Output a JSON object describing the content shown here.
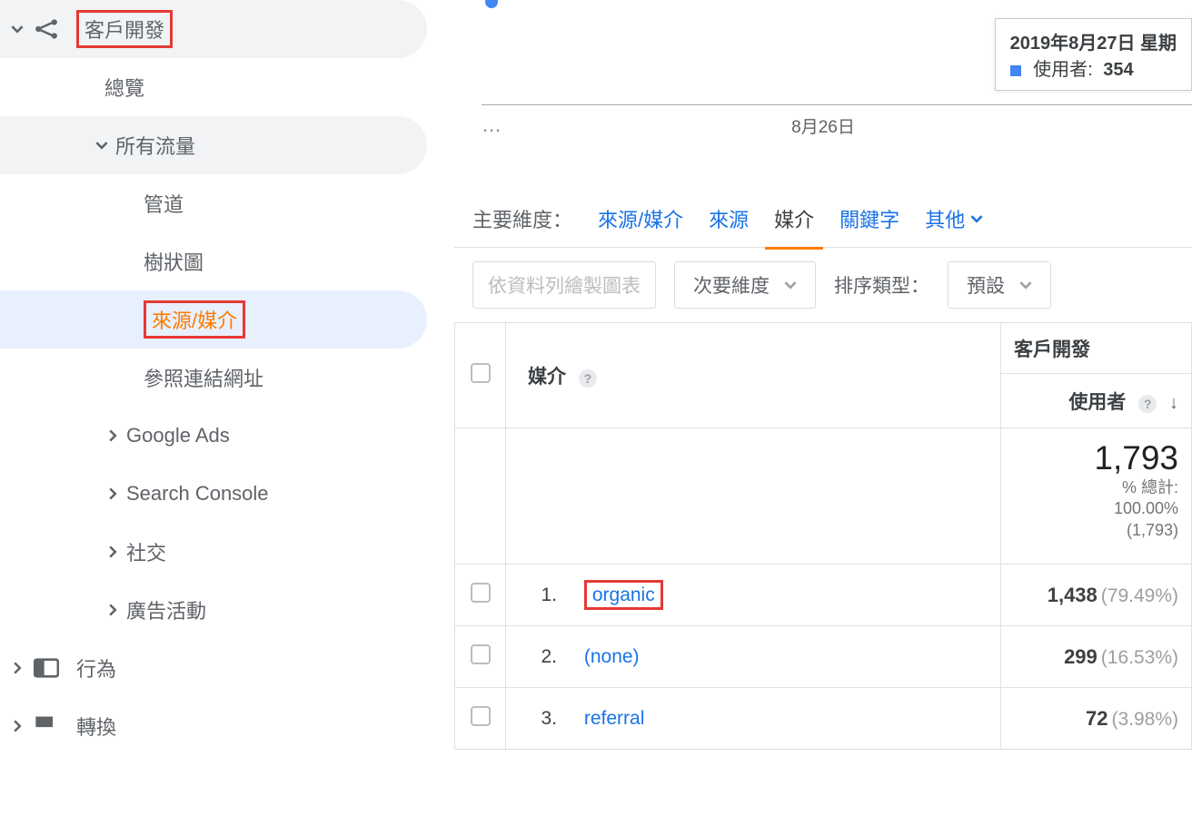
{
  "sidebar": {
    "acquisition_label": "客戶開發",
    "overview_label": "總覽",
    "all_traffic_label": "所有流量",
    "channels_label": "管道",
    "treemap_label": "樹狀圖",
    "source_medium_label": "來源/媒介",
    "referrals_label": "參照連結網址",
    "google_ads_label": "Google Ads",
    "search_console_label": "Search Console",
    "social_label": "社交",
    "campaigns_label": "廣告活動",
    "behavior_label": "行為",
    "conversions_label": "轉換"
  },
  "tooltip": {
    "date_line": "2019年8月27日 星期",
    "users_label": "使用者:",
    "users_value": "354"
  },
  "chart": {
    "axis_date": "8月26日"
  },
  "dims": {
    "label": "主要維度：",
    "source_medium": "來源/媒介",
    "source": "來源",
    "medium": "媒介",
    "keyword": "關鍵字",
    "other": "其他"
  },
  "controls": {
    "plot_rows": "依資料列繪製圖表",
    "secondary": "次要維度",
    "sort_type_label": "排序類型：",
    "default_sort": "預設"
  },
  "table": {
    "group_header": "客戶開發",
    "col_medium": "媒介",
    "col_users": "使用者",
    "summary_users": "1,793",
    "summary_pct_label": "% 總計:",
    "summary_pct": "100.00%",
    "summary_paren": "(1,793)",
    "rows": [
      {
        "idx": "1.",
        "medium": "organic",
        "users": "1,438",
        "pct": "(79.49%)"
      },
      {
        "idx": "2.",
        "medium": "(none)",
        "users": "299",
        "pct": "(16.53%)"
      },
      {
        "idx": "3.",
        "medium": "referral",
        "users": "72",
        "pct": "(3.98%)"
      }
    ]
  }
}
